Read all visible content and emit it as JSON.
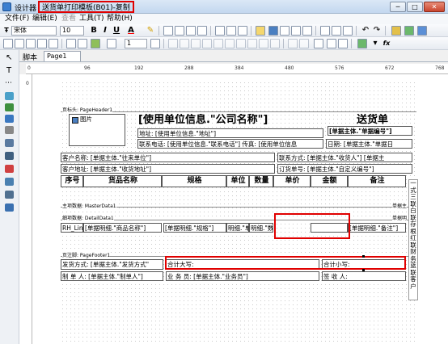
{
  "window": {
    "app_name": "设计器",
    "doc_title": "送货单打印模板(B01)-复制",
    "min": "─",
    "max": "□",
    "close": "✕"
  },
  "menu": [
    "文件(F)",
    "编辑(E)",
    "查看",
    "工具(T)",
    "帮助(H)"
  ],
  "toolbar": {
    "font_name": "宋体",
    "font_size": "10",
    "bold": "B",
    "italic": "I",
    "underline": "U",
    "font_color": "A",
    "line_width": "1",
    "fx": "fx"
  },
  "tabs": {
    "script": "脚本",
    "page": "Page1"
  },
  "ruler": {
    "marks": [
      "0",
      "96",
      "192",
      "288",
      "384",
      "480",
      "576",
      "672",
      "768"
    ]
  },
  "bands": {
    "page_header": "页标头: PageHeader1",
    "master": "主项数据: MasterData1",
    "detail": "细项数据: DetailData1",
    "page_footer": "页注脚: PageFooter1",
    "master_right": "单据主",
    "detail_right": "单据明"
  },
  "header": {
    "picture": "图片",
    "company": "[使用单位信息.\"公司名称\"]",
    "doc_name": "送货单",
    "bill_no": "[单据主体.\"单据编号\"]",
    "address": "地址: [使用单位信息.\"地址\"]",
    "phone": "联系电话: [使用单位信息.\"联系电话\"] 传真: [使用单位信息",
    "date": "日期: [单据主体.\"单据日",
    "customer": "客户名称: [单据主体.\"往来单位\"]",
    "contact": "联系方式: [单据主体.\"收货人\"] [单据主",
    "cust_addr": "客户地址: [单据主体.\"收货地址\"]",
    "order_no": "订货单号: [单据主体.\"自定义编号\"]"
  },
  "columns": [
    "序号",
    "货品名称",
    "规格",
    "单位",
    "数量",
    "单价",
    "金额",
    "备注"
  ],
  "detail": {
    "line": "RH_Lin",
    "product": "[单据明细.\"商品名称\"]",
    "spec": "[单据明细.\"规格\"]",
    "unit": "明细.\"单",
    "qty": "明细.\"数",
    "note": "[单据明细.\"备注\"]"
  },
  "footer": {
    "ship": "发货方式: [单据主体.\"发货方式\"",
    "total_big": "合计大写:",
    "total_small": "合计小写:",
    "maker": "制 单 人: [单据主体.\"制单人\"]",
    "sales": "业 务 员: [单据主体.\"业务员\"]",
    "receiver": "签 收 人:"
  },
  "side_note": "一式三联 白联存根 红联财务 蓝联客户",
  "colors": {
    "highlight": "#e00000",
    "titlebar": "#c3d7ef"
  }
}
